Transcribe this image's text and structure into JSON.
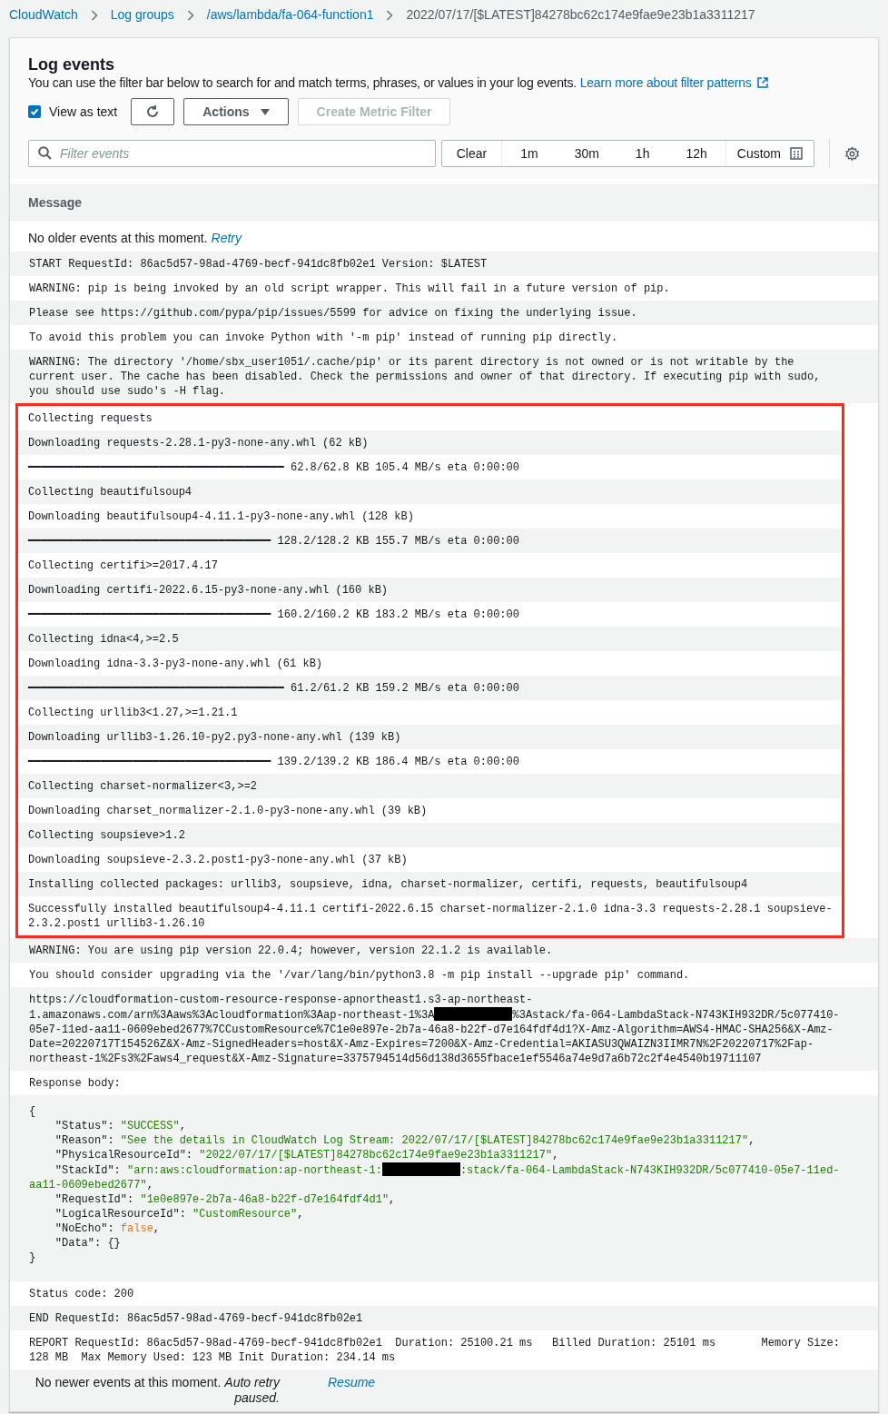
{
  "breadcrumbs": [
    {
      "label": "CloudWatch",
      "current": false
    },
    {
      "label": "Log groups",
      "current": false
    },
    {
      "label": "/aws/lambda/fa-064-function1",
      "current": false
    },
    {
      "label": "2022/07/17/[$LATEST]84278bc62c174e9fae9e23b1a3311217",
      "current": true
    }
  ],
  "panel": {
    "title": "Log events",
    "description": "You can use the filter bar below to search for and match terms, phrases, or values in your log events.",
    "learn_more_link": "Learn more about filter patterns"
  },
  "toolbar": {
    "view_as_text": {
      "label": "View as text",
      "checked": true
    },
    "actions": {
      "label": "Actions"
    },
    "create_metric_filter": {
      "label": "Create Metric Filter",
      "disabled": true
    }
  },
  "filter": {
    "placeholder": "Filter events"
  },
  "time_range": [
    {
      "label": "Clear",
      "selected": false
    },
    {
      "label": "1m",
      "selected": false
    },
    {
      "label": "30m",
      "selected": false
    },
    {
      "label": "1h",
      "selected": false
    },
    {
      "label": "12h",
      "selected": false
    },
    {
      "label": "Custom",
      "selected": false
    }
  ],
  "column_header": "Message",
  "older_notice": {
    "text": "No older events at this moment.",
    "link": "Retry"
  },
  "events": [
    {
      "kind": "line",
      "text": "START RequestId: 86ac5d57-98ad-4769-becf-941dc8fb02e1 Version: $LATEST"
    },
    {
      "kind": "line",
      "text": "WARNING: pip is being invoked by an old script wrapper. This will fail in a future version of pip."
    },
    {
      "kind": "line",
      "text": "Please see https://github.com/pypa/pip/issues/5599 for advice on fixing the underlying issue."
    },
    {
      "kind": "line",
      "text": "To avoid this problem you can invoke Python with '-m pip' instead of running pip directly."
    },
    {
      "kind": "line",
      "text": "WARNING: The directory '/home/sbx_user1051/.cache/pip' or its parent directory is not owned or is not writable by the current user. The cache has been disabled. Check the permissions and owner of that directory. If executing pip with sudo, you should use sudo's -H flag."
    }
  ],
  "highlighted_events": [
    {
      "kind": "line",
      "text": "Collecting requests"
    },
    {
      "kind": "line",
      "text": "Downloading requests-2.28.1-py3-none-any.whl (62 kB)"
    },
    {
      "kind": "line",
      "text": "━━━━━━━━━━━━━━━━━━━━━━━━━━━━━━━━━━━━━━━ 62.8/62.8 KB 105.4 MB/s eta 0:00:00"
    },
    {
      "kind": "line",
      "text": "Collecting beautifulsoup4"
    },
    {
      "kind": "line",
      "text": "Downloading beautifulsoup4-4.11.1-py3-none-any.whl (128 kB)"
    },
    {
      "kind": "line",
      "text": "━━━━━━━━━━━━━━━━━━━━━━━━━━━━━━━━━━━━━ 128.2/128.2 KB 155.7 MB/s eta 0:00:00"
    },
    {
      "kind": "line",
      "text": "Collecting certifi>=2017.4.17"
    },
    {
      "kind": "line",
      "text": "Downloading certifi-2022.6.15-py3-none-any.whl (160 kB)"
    },
    {
      "kind": "line",
      "text": "━━━━━━━━━━━━━━━━━━━━━━━━━━━━━━━━━━━━━ 160.2/160.2 KB 183.2 MB/s eta 0:00:00"
    },
    {
      "kind": "line",
      "text": "Collecting idna<4,>=2.5"
    },
    {
      "kind": "line",
      "text": "Downloading idna-3.3-py3-none-any.whl (61 kB)"
    },
    {
      "kind": "line",
      "text": "━━━━━━━━━━━━━━━━━━━━━━━━━━━━━━━━━━━━━━━ 61.2/61.2 KB 159.2 MB/s eta 0:00:00"
    },
    {
      "kind": "line",
      "text": "Collecting urllib3<1.27,>=1.21.1"
    },
    {
      "kind": "line",
      "text": "Downloading urllib3-1.26.10-py2.py3-none-any.whl (139 kB)"
    },
    {
      "kind": "line",
      "text": "━━━━━━━━━━━━━━━━━━━━━━━━━━━━━━━━━━━━━ 139.2/139.2 KB 186.4 MB/s eta 0:00:00"
    },
    {
      "kind": "line",
      "text": "Collecting charset-normalizer<3,>=2"
    },
    {
      "kind": "line",
      "text": "Downloading charset_normalizer-2.1.0-py3-none-any.whl (39 kB)"
    },
    {
      "kind": "line",
      "text": "Collecting soupsieve>1.2"
    },
    {
      "kind": "line",
      "text": "Downloading soupsieve-2.3.2.post1-py3-none-any.whl (37 kB)"
    },
    {
      "kind": "line",
      "text": "Installing collected packages: urllib3, soupsieve, idna, charset-normalizer, certifi, requests, beautifulsoup4"
    },
    {
      "kind": "line",
      "text": "Successfully installed beautifulsoup4-4.11.1 certifi-2022.6.15 charset-normalizer-2.1.0 idna-3.3 requests-2.28.1 soupsieve-2.3.2.post1 urllib3-1.26.10"
    }
  ],
  "events_after": [
    {
      "kind": "line",
      "text": "WARNING: You are using pip version 22.0.4; however, version 22.1.2 is available."
    },
    {
      "kind": "line",
      "text": "You should consider upgrading via the '/var/lang/bin/python3.8 -m pip install --upgrade pip' command."
    },
    {
      "kind": "segments",
      "parts": [
        {
          "kind": "text",
          "text": "https://cloudformation-custom-resource-response-apnortheast1.s3-ap-northeast-1.amazonaws.com/arn%3Aaws%3Acloudformation%3Aap-northeast-1%3A"
        },
        {
          "kind": "redacted"
        },
        {
          "kind": "text",
          "text": "%3Astack/fa-064-LambdaStack-N743KIH932DR/5c077410-05e7-11ed-aa11-0609ebed2677%7CCustomResource%7C1e0e897e-2b7a-46a8-b22f-d7e164fdf4d1?X-Amz-Algorithm=AWS4-HMAC-SHA256&X-Amz-Date=20220717T154526Z&X-Amz-SignedHeaders=host&X-Amz-Expires=7200&X-Amz-Credential=AKIASU3QWAIZN3IIMR7N%2F20220717%2Fap-northeast-1%2Fs3%2Faws4_request&X-Amz-Signature=3375794514d56d138d3655fbace1ef5546a74e9d7a6b72c2f4e4540b19711107"
        }
      ]
    },
    {
      "kind": "line",
      "text": "Response body:"
    },
    {
      "kind": "json",
      "lines": [
        [
          {
            "kind": "plain",
            "text": "{"
          }
        ],
        [
          {
            "kind": "plain",
            "text": "    \"Status\": "
          },
          {
            "kind": "string",
            "text": "\"SUCCESS\""
          },
          {
            "kind": "plain",
            "text": ","
          }
        ],
        [
          {
            "kind": "plain",
            "text": "    \"Reason\": "
          },
          {
            "kind": "string",
            "text": "\"See the details in CloudWatch Log Stream: 2022/07/17/[$LATEST]84278bc62c174e9fae9e23b1a3311217\""
          },
          {
            "kind": "plain",
            "text": ","
          }
        ],
        [
          {
            "kind": "plain",
            "text": "    \"PhysicalResourceId\": "
          },
          {
            "kind": "string",
            "text": "\"2022/07/17/[$LATEST]84278bc62c174e9fae9e23b1a3311217\""
          },
          {
            "kind": "plain",
            "text": ","
          }
        ],
        [
          {
            "kind": "plain",
            "text": "    \"StackId\": "
          },
          {
            "kind": "string",
            "text": "\"arn:aws:cloudformation:ap-northeast-1:"
          },
          {
            "kind": "redacted"
          },
          {
            "kind": "string",
            "text": ":stack/fa-064-LambdaStack-N743KIH932DR/5c077410-05e7-11ed-aa11-0609ebed2677\""
          },
          {
            "kind": "plain",
            "text": ","
          }
        ],
        [
          {
            "kind": "plain",
            "text": "    \"RequestId\": "
          },
          {
            "kind": "string",
            "text": "\"1e0e897e-2b7a-46a8-b22f-d7e164fdf4d1\""
          },
          {
            "kind": "plain",
            "text": ","
          }
        ],
        [
          {
            "kind": "plain",
            "text": "    \"LogicalResourceId\": "
          },
          {
            "kind": "string",
            "text": "\"CustomResource\""
          },
          {
            "kind": "plain",
            "text": ","
          }
        ],
        [
          {
            "kind": "plain",
            "text": "    \"NoEcho\": "
          },
          {
            "kind": "literal",
            "text": "false"
          },
          {
            "kind": "plain",
            "text": ","
          }
        ],
        [
          {
            "kind": "plain",
            "text": "    \"Data\": {}"
          }
        ],
        [
          {
            "kind": "plain",
            "text": "}"
          }
        ]
      ]
    },
    {
      "kind": "line",
      "text": "Status code: 200"
    },
    {
      "kind": "line",
      "text": "END RequestId: 86ac5d57-98ad-4769-becf-941dc8fb02e1"
    },
    {
      "kind": "line",
      "text": "REPORT RequestId: 86ac5d57-98ad-4769-becf-941dc8fb02e1  Duration: 25100.21 ms   Billed Duration: 25101 ms       Memory Size: 128 MB  Max Memory Used: 123 MB Init Duration: 234.14 ms"
    }
  ],
  "newer_notice": {
    "text": "No newer events at this moment.",
    "italic_text": "Auto retry paused.",
    "link": "Resume"
  }
}
